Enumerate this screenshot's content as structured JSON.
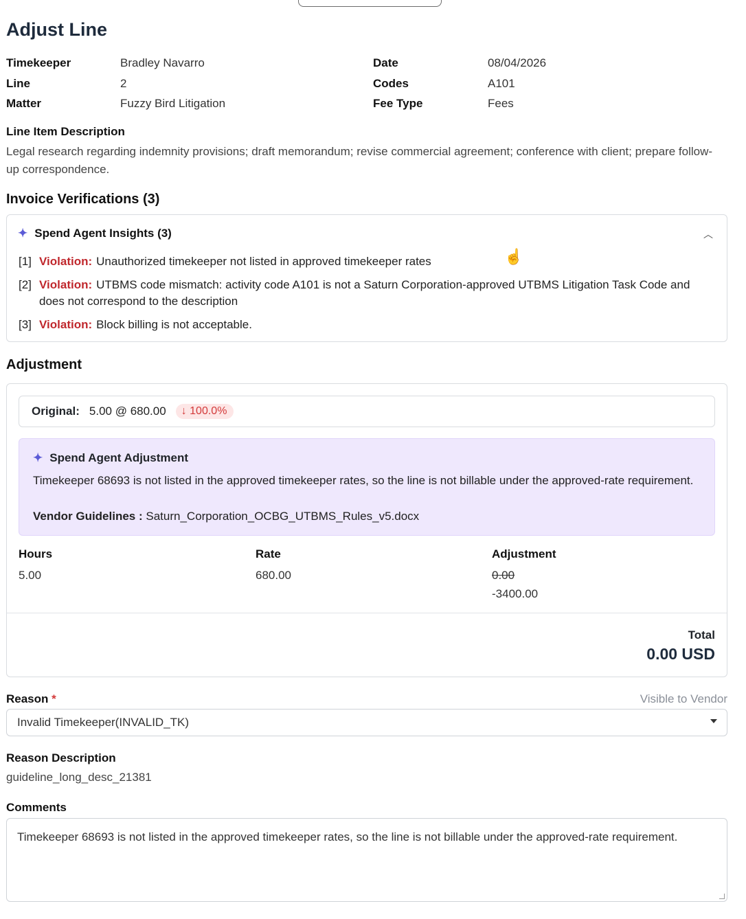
{
  "page": {
    "title": "Adjust Line"
  },
  "meta": {
    "timekeeper_label": "Timekeeper",
    "timekeeper": "Bradley Navarro",
    "line_label": "Line",
    "line": "2",
    "matter_label": "Matter",
    "matter": "Fuzzy Bird Litigation",
    "date_label": "Date",
    "date": "08/04/2026",
    "codes_label": "Codes",
    "codes": "A101",
    "fee_type_label": "Fee Type",
    "fee_type": "Fees"
  },
  "description": {
    "label": "Line Item Description",
    "text": "Legal research regarding indemnity provisions; draft memorandum; revise commercial agreement; conference with client; prepare follow-up correspondence."
  },
  "verifications": {
    "title": "Invoice Verifications (3)",
    "insights_title": "Spend Agent Insights (3)",
    "items": [
      {
        "index": "[1]",
        "tag": "Violation:",
        "text": "Unauthorized timekeeper not listed in approved timekeeper rates"
      },
      {
        "index": "[2]",
        "tag": "Violation:",
        "text": "UTBMS code mismatch: activity code A101 is not a Saturn Corporation-approved UTBMS Litigation Task Code and does not correspond to the description"
      },
      {
        "index": "[3]",
        "tag": "Violation:",
        "text": "Block billing is not acceptable."
      }
    ]
  },
  "adjustment": {
    "title": "Adjustment",
    "original_label": "Original:",
    "original_value": "5.00 @ 680.00",
    "change_pct": "100.0%",
    "agent": {
      "title": "Spend Agent Adjustment",
      "body": "Timekeeper 68693 is not listed in the approved timekeeper rates, so the line is not billable under the approved-rate requirement.",
      "guidelines_label": "Vendor Guidelines :",
      "guidelines_file": "Saturn_Corporation_OCBG_UTBMS_Rules_v5.docx"
    },
    "hours_label": "Hours",
    "hours": "5.00",
    "rate_label": "Rate",
    "rate": "680.00",
    "adjustment_label": "Adjustment",
    "adjustment_old": "0.00",
    "adjustment_new": "-3400.00",
    "total_label": "Total",
    "total": "0.00 USD"
  },
  "reason": {
    "label": "Reason",
    "required_mark": "*",
    "visibility": "Visible to Vendor",
    "selected": "Invalid Timekeeper(INVALID_TK)"
  },
  "reason_description": {
    "label": "Reason Description",
    "value": "guideline_long_desc_21381"
  },
  "comments": {
    "label": "Comments",
    "value": "Timekeeper 68693 is not listed in the approved timekeeper rates, so the line is not billable under the approved-rate requirement."
  },
  "colors": {
    "violation": "#c0282d",
    "accent": "#5b5bd6",
    "agent_bg": "#efe8fd",
    "strike": "#7d3fe0"
  }
}
